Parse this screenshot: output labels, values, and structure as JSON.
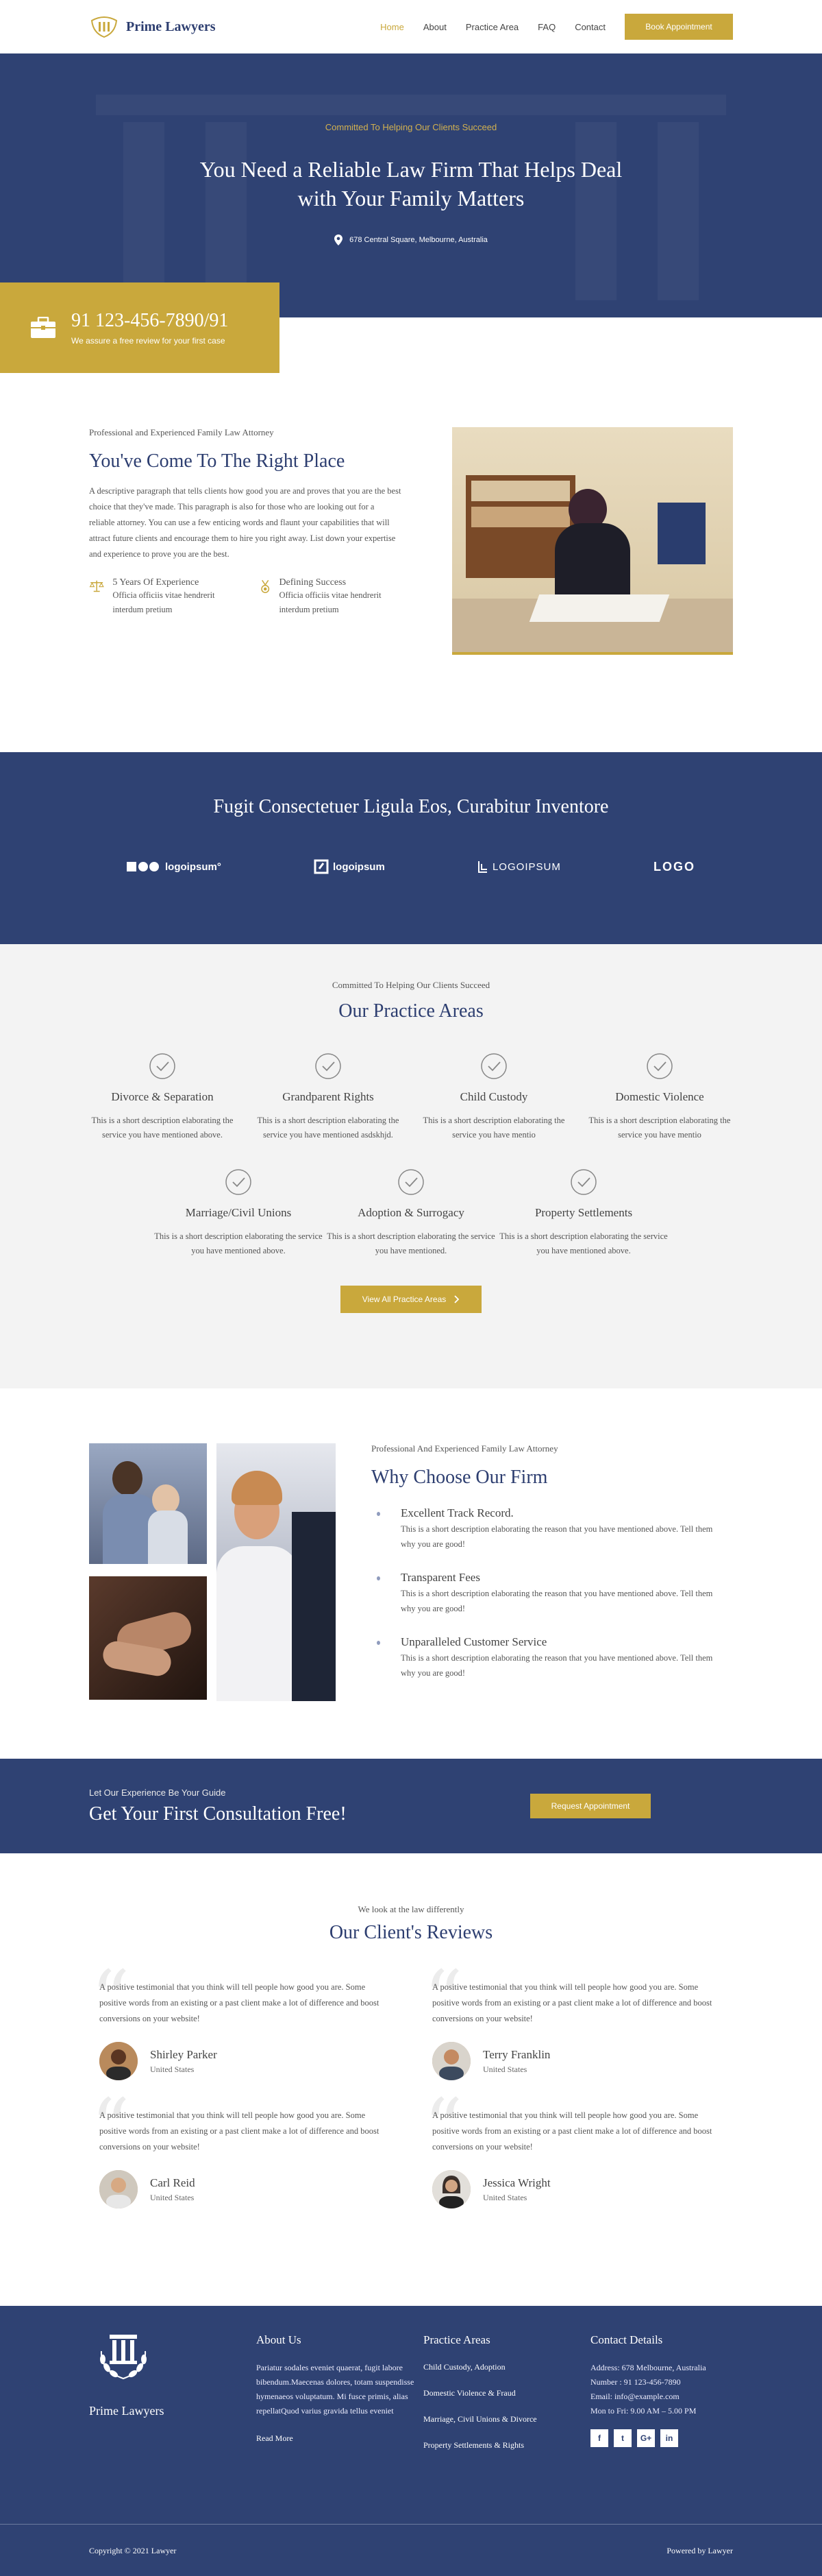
{
  "header": {
    "brand": "Prime Lawyers",
    "nav": [
      "Home",
      "About",
      "Practice Area",
      "FAQ",
      "Contact"
    ],
    "cta": "Book Appointment"
  },
  "hero": {
    "kicker": "Committed To Helping Our Clients Succeed",
    "title_line1": "You Need a Reliable Law Firm That Helps Deal",
    "title_line2": "with Your Family Matters",
    "address": "678 Central Square, Melbourne, Australia"
  },
  "phone": {
    "number": "91 123-456-7890/91",
    "sub": "We assure a free review for your first case"
  },
  "about": {
    "kicker": "Professional and Experienced Family Law Attorney",
    "title": "You've Come To The Right Place",
    "paragraph": "A descriptive paragraph that tells clients how good you are and proves that you are the best choice that they've made. This paragraph is also for those who are looking out for a reliable attorney. You can use a few enticing words and flaunt your capabilities that will attract future clients and encourage them to hire you right away. List down your expertise and experience to prove you are the best.",
    "features": [
      {
        "title": "5 Years Of Experience",
        "desc": "Officia officiis vitae hendrerit interdum pretium"
      },
      {
        "title": "Defining Success",
        "desc": "Officia officiis vitae hendrerit interdum pretium"
      }
    ]
  },
  "band": {
    "title": "Fugit Consectetuer Ligula Eos, Curabitur Inventore",
    "logos": [
      "logoipsum°",
      "logoipsum",
      "LOGOIPSUM",
      "LOGO"
    ]
  },
  "practice": {
    "kicker": "Committed To Helping Our Clients Succeed",
    "title": "Our Practice Areas",
    "row1": [
      {
        "title": "Divorce & Separation",
        "desc": "This is a short description elaborating the service you have mentioned above."
      },
      {
        "title": "Grandparent Rights",
        "desc": "This is a short description elaborating the service you have mentioned asdskhjd."
      },
      {
        "title": "Child Custody",
        "desc": "This is a short description elaborating the service you have mentio"
      },
      {
        "title": "Domestic Violence",
        "desc": "This is a short description elaborating the service you have mentio"
      }
    ],
    "row2": [
      {
        "title": "Marriage/Civil Unions",
        "desc": "This is a short description elaborating the service you have mentioned above."
      },
      {
        "title": "Adoption & Surrogacy",
        "desc": "This is a short description elaborating the service you have mentioned."
      },
      {
        "title": "Property Settlements",
        "desc": "This is a short description elaborating the service you have mentioned above."
      }
    ],
    "button": "View All Practice Areas"
  },
  "why": {
    "kicker": "Professional And Experienced Family Law Attorney",
    "title": "Why Choose Our Firm",
    "items": [
      {
        "title": "Excellent Track Record.",
        "desc": "This is a short description elaborating the reason that you have mentioned above. Tell them why you are good!"
      },
      {
        "title": "Transparent Fees",
        "desc": "This is a short description elaborating the reason that you have mentioned above. Tell them why you are good!"
      },
      {
        "title": "Unparalleled Customer Service",
        "desc": "This is a short description elaborating the reason that you have mentioned above. Tell them why you are good!"
      }
    ]
  },
  "cta": {
    "kicker": "Let Our Experience Be Your Guide",
    "title": "Get Your First Consultation Free!",
    "button": "Request Appointment"
  },
  "reviews": {
    "kicker": "We look at the law differently",
    "title": "Our Client's Reviews",
    "items": [
      {
        "text": "A positive testimonial that you think will tell people how good you are. Some positive words from an existing or a past client make a lot of difference and boost conversions on your website!",
        "name": "Shirley Parker",
        "country": "United States"
      },
      {
        "text": "A positive testimonial that you think will tell people how good you are. Some positive words from an existing or a past client make a lot of difference and boost conversions on your website!",
        "name": "Terry Franklin",
        "country": "United States"
      },
      {
        "text": "A positive testimonial that you think will tell people how good you are. Some positive words from an existing or a past client make a lot of difference and boost conversions on your website!",
        "name": "Carl Reid",
        "country": "United States"
      },
      {
        "text": "A positive testimonial that you think will tell people how good you are. Some positive words from an existing or a past client make a lot of difference and boost conversions on your website!",
        "name": "Jessica Wright",
        "country": "United States"
      }
    ]
  },
  "footer": {
    "brand": "Prime Lawyers",
    "about_title": "About Us",
    "about_text": "Pariatur sodales eveniet quaerat, fugit labore bibendum.Maecenas dolores, totam suspendisse hymenaeos voluptatum. Mi fusce primis, alias repellatQuod varius gravida tellus eveniet",
    "read_more": "Read More",
    "practice_title": "Practice Areas",
    "practice_links": [
      "Child Custody, Adoption",
      "Domestic Violence & Fraud",
      "Marriage, Civil Unions & Divorce",
      "Property Settlements & Rights"
    ],
    "contact_title": "Contact Details",
    "contact": [
      "Address: 678 Melbourne, Australia",
      "Number : 91 123-456-7890",
      "Email: info@example.com",
      "Mon to Fri: 9.00 AM – 5.00 PM"
    ],
    "social": [
      "f",
      "t",
      "G+",
      "in"
    ],
    "copyright": "Copyright © 2021 Lawyer",
    "powered": "Powered by Lawyer"
  },
  "colors": {
    "navy": "#2f4273",
    "gold": "#c9a83c"
  }
}
